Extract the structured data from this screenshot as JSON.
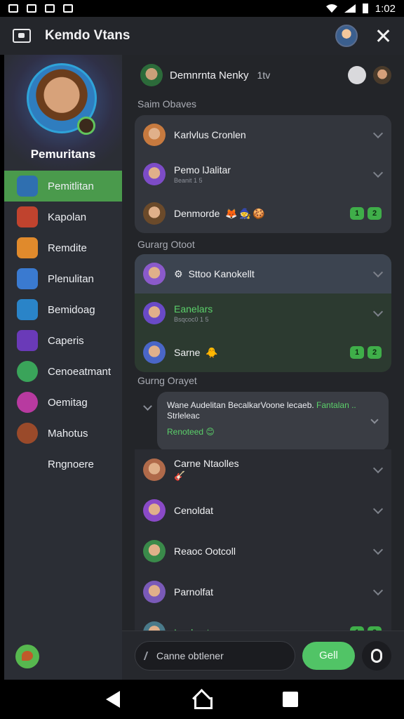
{
  "status_bar": {
    "time": "1:02"
  },
  "app_bar": {
    "title": "Kemdo Vtans"
  },
  "sidebar": {
    "profile_name": "Pemuritans",
    "items": [
      {
        "label": "Pemitlitan",
        "icon": "hero-icon",
        "color": "#2f6fb0",
        "active": true
      },
      {
        "label": "Kapolan",
        "icon": "archer-icon",
        "color": "#c0432e"
      },
      {
        "label": "Remdite",
        "icon": "warrior-icon",
        "color": "#e08a2c"
      },
      {
        "label": "Plenulitan",
        "icon": "spear-icon",
        "color": "#3a7ad0"
      },
      {
        "label": "Bemidoag",
        "icon": "sword-icon",
        "color": "#2a84c8"
      },
      {
        "label": "Caperis",
        "icon": "v-shield-icon",
        "color": "#6a3ab8"
      },
      {
        "label": "Cenoeatmant",
        "icon": "leaf-icon",
        "color": "#3aa45a"
      },
      {
        "label": "Oemitag",
        "icon": "orb-icon",
        "color": "#b83aa0"
      },
      {
        "label": "Mahotus",
        "icon": "beast-icon",
        "color": "#9a4a2a"
      },
      {
        "label": "Rngnoere",
        "icon": "",
        "color": ""
      }
    ]
  },
  "room": {
    "title": "Demnrnta Nenky",
    "count": "1tv"
  },
  "sections": {
    "s1": "Saim Obaves",
    "s2": "Gurarg Otoot",
    "s3": "Gurng Orayet"
  },
  "card1": [
    {
      "name": "Karlvlus Cronlen",
      "sub": "",
      "color": "#c77a3f",
      "trail": "chevron"
    },
    {
      "name": "Pemo lJalitar",
      "sub": "Beanit 1 5",
      "color": "#7d4cc7",
      "trail": "chevron"
    },
    {
      "name": "Denmorde",
      "sub": "",
      "color": "#6b4a2a",
      "trail": "badges",
      "emojis": "🦊🧙🍪",
      "badges": [
        "1",
        "2"
      ]
    }
  ],
  "card2": [
    {
      "name": "Sttoo Kanokellt",
      "sub": "",
      "color": "#8b5acb",
      "trail": "chevron",
      "highlight": true,
      "prefix": "⚙"
    },
    {
      "name": "Eanelars",
      "sub": "Bsqcoc0 1 5",
      "color": "#6a4ac7",
      "trail": "chevron",
      "green": true
    },
    {
      "name": "Sarne",
      "sub": "",
      "color": "#4a66c7",
      "trail": "badges",
      "emojis": "🐥",
      "badges": [
        "1",
        "2"
      ]
    }
  ],
  "message": {
    "text_white": "Wane Audelitan BecalkarVoone lecaeb.",
    "text_green": " Fantalan ..",
    "text_line2": "Strleleac",
    "reply": "Renoteed",
    "reply_emoji": "😊"
  },
  "list3": [
    {
      "name": "Carne Ntaolles",
      "sub": "🎸",
      "color": "#b06a4a",
      "trail": "chevron"
    },
    {
      "name": "Cenoldat",
      "sub": "",
      "color": "#8a4ac7",
      "trail": "chevron"
    },
    {
      "name": "Reaoc Ootcoll",
      "sub": "",
      "color": "#3a8a4a",
      "trail": "chevron"
    },
    {
      "name": "Parnolfat",
      "sub": "",
      "color": "#7a5ab8",
      "trail": "chevron"
    },
    {
      "name": "Inedyerts",
      "sub": "",
      "color": "#4a7a8a",
      "trail": "badges",
      "green": true,
      "badges": [
        "1",
        "2"
      ]
    }
  ],
  "composer": {
    "placeholder": "Canne obtlener",
    "send_label": "Gell"
  }
}
